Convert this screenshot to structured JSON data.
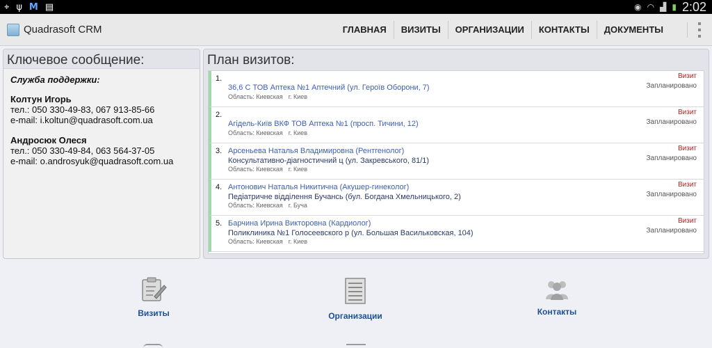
{
  "statusbar": {
    "left_icons": [
      "gps-icon",
      "usb-icon",
      "gmail-icon",
      "sim-icon"
    ],
    "time": "2:02"
  },
  "app": {
    "title": "Quadrasoft CRM"
  },
  "nav": [
    {
      "label": "ГЛАВНАЯ"
    },
    {
      "label": "ВИЗИТЫ"
    },
    {
      "label": "ОРГАНИЗАЦИИ"
    },
    {
      "label": "КОНТАКТЫ"
    },
    {
      "label": "ДОКУМЕНТЫ"
    }
  ],
  "key_message": {
    "title": "Ключевое сообщение:",
    "support_title": "Служба поддержки:",
    "contacts": [
      {
        "name": "Колтун Игорь",
        "phone": "тел.: 050 330-49-83, 067 913-85-66",
        "email": "e-mail: i.koltun@quadrasoft.com.ua"
      },
      {
        "name": "Андросюк Олеся",
        "phone": "тел.: 050 330-49-84, 063 564-37-05",
        "email": "e-mail: o.androsyuk@quadrasoft.com.ua"
      }
    ]
  },
  "visit_plan": {
    "title": "План визитов:",
    "visits": [
      {
        "num": "1.",
        "person": "",
        "org": "36,6 С ТОВ Аптека №1 Аптечний  (ул. Героїв Оборони, 7)",
        "region": "Область: Киевская",
        "city": "г. Киев",
        "type": "Визит",
        "status": "Запланировано"
      },
      {
        "num": "2.",
        "person": "",
        "org": "Агідель-Київ ВКФ ТОВ Аптека №1 (просп. Тичини, 12)",
        "region": "Область: Киевская",
        "city": "г. Киев",
        "type": "Визит",
        "status": "Запланировано"
      },
      {
        "num": "3.",
        "person": "Арсеньева Наталья Владимировна (Рентгенолог)",
        "org": "Консультативно-діагностичний ц (ул. Закревського, 81/1)",
        "region": "Область: Киевская",
        "city": "г. Киев",
        "type": "Визит",
        "status": "Запланировано"
      },
      {
        "num": "4.",
        "person": "Антонович Наталья Никитична (Акушер-гинеколог)",
        "org": "Педіатричне відділення Бучансь (бул. Богдана Хмельницького, 2)",
        "region": "Область: Киевская",
        "city": "г. Буча",
        "type": "Визит",
        "status": "Запланировано"
      },
      {
        "num": "5.",
        "person": "Барчина Ирина Викторовна (Кардиолог)",
        "org": "Поликлиника №1 Голосеевского р (ул. Большая Васильковская, 104)",
        "region": "Область: Киевская",
        "city": "г. Киев",
        "type": "Визит",
        "status": "Запланировано"
      }
    ]
  },
  "tiles": [
    {
      "label": "Визиты",
      "icon": "visit-edit-icon"
    },
    {
      "label": "Организации",
      "icon": "organizations-list-icon"
    },
    {
      "label": "Контакты",
      "icon": "contacts-people-icon"
    }
  ],
  "colors": {
    "accent_link": "#3c5fae",
    "visit_type": "#b02020",
    "row_marker": "#9fd9a8",
    "tile_label": "#1d4f94"
  }
}
